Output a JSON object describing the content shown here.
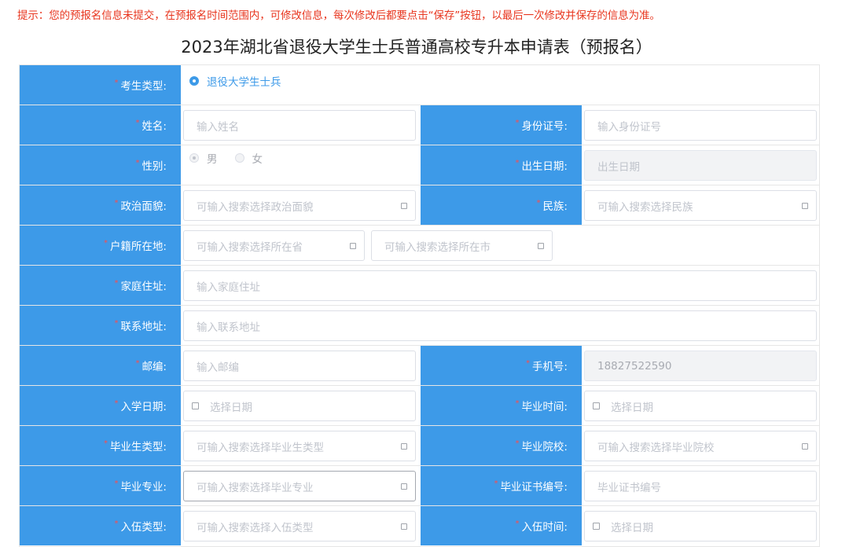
{
  "notice": "提示：您的预报名信息未提交，在预报名时间范围内，可修改信息，每次修改后都要点击“保存”按钮，以最后一次修改并保存的信息为准。",
  "title": "2023年湖北省退役大学生士兵普通高校专升本申请表（预报名）",
  "required_mark": "*",
  "labels": {
    "exam_type": "考生类型:",
    "name": "姓名:",
    "id_no": "身份证号:",
    "gender": "性别:",
    "birth": "出生日期:",
    "politics": "政治面貌:",
    "ethnic": "民族:",
    "hukou": "户籍所在地:",
    "home_addr": "家庭住址:",
    "contact_addr": "联系地址:",
    "zip": "邮编:",
    "phone": "手机号:",
    "enroll_date": "入学日期:",
    "grad_time": "毕业时间:",
    "grad_type": "毕业生类型:",
    "grad_school": "毕业院校:",
    "grad_major": "毕业专业:",
    "cert_no": "毕业证书编号:",
    "enlist_type": "入伍类型:",
    "enlist_time": "入伍时间:"
  },
  "exam_type_option": "退役大学生士兵",
  "gender_options": [
    "男",
    "女"
  ],
  "placeholders": {
    "name": "输入姓名",
    "id_no": "输入身份证号",
    "birth": "出生日期",
    "politics": "可输入搜索选择政治面貌",
    "ethnic": "可输入搜索选择民族",
    "province": "可输入搜索选择所在省",
    "city": "可输入搜索选择所在市",
    "home_addr": "输入家庭住址",
    "contact_addr": "输入联系地址",
    "zip": "输入邮编",
    "date": "选择日期",
    "grad_type": "可输入搜索选择毕业生类型",
    "grad_school": "可输入搜索选择毕业院校",
    "grad_major": "可输入搜索选择毕业专业",
    "cert_no": "毕业证书编号",
    "enlist_type": "可输入搜索选择入伍类型"
  },
  "values": {
    "phone": "18827522590"
  }
}
